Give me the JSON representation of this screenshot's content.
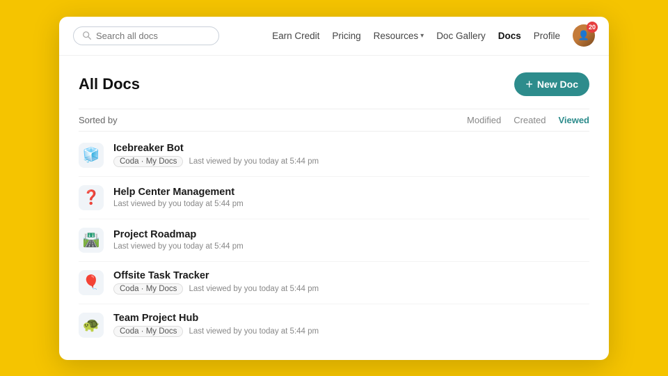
{
  "header": {
    "search_placeholder": "Search all docs",
    "nav_items": [
      {
        "label": "Earn Credit",
        "active": false
      },
      {
        "label": "Pricing",
        "active": false
      },
      {
        "label": "Resources",
        "has_dropdown": true,
        "active": false
      },
      {
        "label": "Doc Gallery",
        "active": false
      },
      {
        "label": "Docs",
        "active": true
      },
      {
        "label": "Profile",
        "active": false
      }
    ],
    "avatar_badge": "20"
  },
  "main": {
    "title": "All Docs",
    "new_doc_btn": "New Doc",
    "sort_label": "Sorted by",
    "sort_options": [
      {
        "label": "Modified",
        "active": false
      },
      {
        "label": "Created",
        "active": false
      },
      {
        "label": "Viewed",
        "active": true
      }
    ],
    "docs": [
      {
        "name": "Icebreaker Bot",
        "icon": "🧊",
        "tag": "Coda · My Docs",
        "viewed": "Last viewed by you today at 5:44 pm"
      },
      {
        "name": "Help Center Management",
        "icon": "❓",
        "tag": null,
        "viewed": "Last viewed by you today at 5:44 pm"
      },
      {
        "name": "Project Roadmap",
        "icon": "🛣️",
        "tag": null,
        "viewed": "Last viewed by you today at 5:44 pm"
      },
      {
        "name": "Offsite Task Tracker",
        "icon": "🎈",
        "tag": "Coda · My Docs",
        "viewed": "Last viewed by you today at 5:44 pm"
      },
      {
        "name": "Team Project Hub",
        "icon": "🐢",
        "tag": "Coda · My Docs",
        "viewed": "Last viewed by you today at 5:44 pm"
      }
    ]
  }
}
